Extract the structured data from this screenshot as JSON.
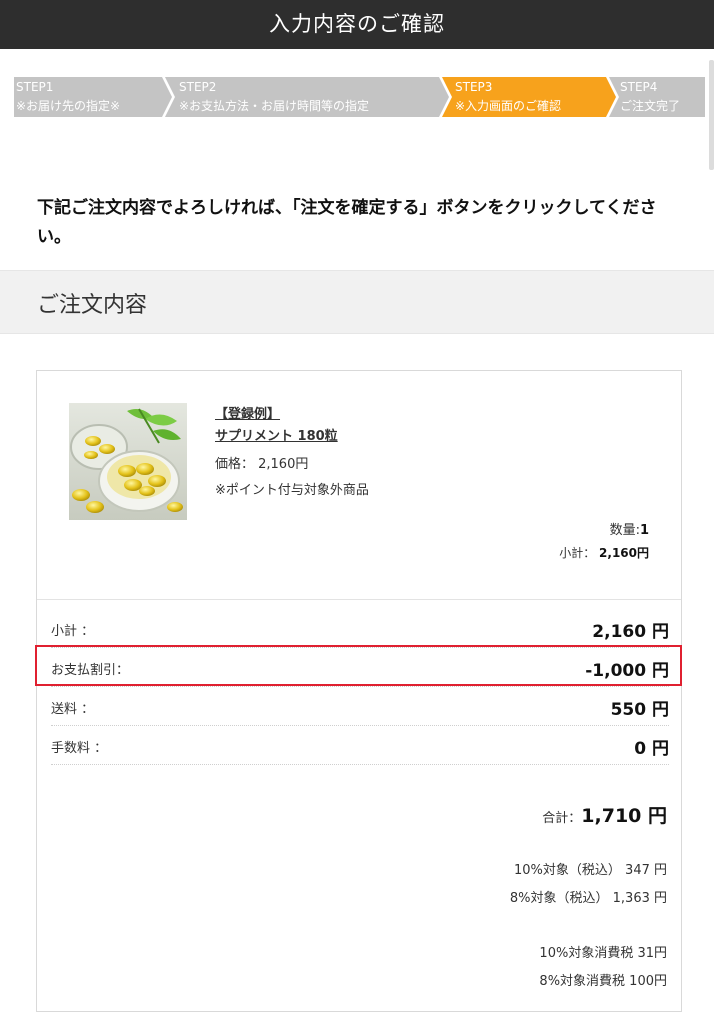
{
  "header": {
    "title": "入力内容のご確認"
  },
  "steps": [
    {
      "step": "STEP1",
      "label": "※お届け先の指定※",
      "active": false
    },
    {
      "step": "STEP2",
      "label": "※お支払方法・お届け時間等の指定",
      "active": false
    },
    {
      "step": "STEP3",
      "label": "※入力画面のご確認",
      "active": true
    },
    {
      "step": "STEP4",
      "label": "ご注文完了",
      "active": false
    }
  ],
  "colors": {
    "step_inactive": "#c4c4c4",
    "step_active": "#f7a21c",
    "highlight": "#e02030"
  },
  "instruction": "下記ご注文内容でよろしければ、「注文を確定する」ボタンをクリックしてください。",
  "section_title": "ご注文内容",
  "product": {
    "tag": "【登録例】",
    "name": "サプリメント 180粒",
    "price": "価格： 2,160円",
    "note": "※ポイント付与対象外商品",
    "quantity_label": "数量:",
    "quantity_value": "1",
    "subtotal_label": "小計：",
    "subtotal_value": "2,160円",
    "image_icon": "supplement-capsules-photo"
  },
  "summary": {
    "subtotal": {
      "label": "小計 ：",
      "value": "2,160 円"
    },
    "discount": {
      "label": "お支払割引：",
      "value": "-1,000 円"
    },
    "shipping": {
      "label": "送料 ：",
      "value": "550 円"
    },
    "fee": {
      "label": "手数料 ：",
      "value": "0 円"
    },
    "total_label": "合計：",
    "total_value": "1,710 円",
    "tax_breakdown": [
      "10%対象（税込） 347 円",
      "8%対象（税込） 1,363 円",
      "10%対象消費税 31円",
      "8%対象消費税 100円"
    ]
  }
}
